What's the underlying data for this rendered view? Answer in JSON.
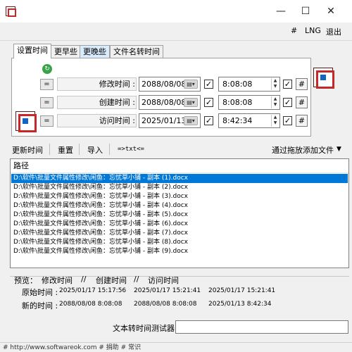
{
  "window": {
    "minimize": "—",
    "maximize": "☐",
    "close": "✕"
  },
  "toolbar": {
    "hash": "#",
    "lng": "LNG",
    "exit": "退出"
  },
  "tabs": [
    "设置时间",
    "更早些",
    "更晚些",
    "文件名转时间"
  ],
  "time_rows": [
    {
      "eq": "=",
      "label": "修改时间 :",
      "date": "2088/08/08",
      "time": "8:08:08",
      "hash": "#"
    },
    {
      "eq": "=",
      "label": "创建时间 :",
      "date": "2088/08/08",
      "time": "8:08:08",
      "hash": "#"
    },
    {
      "eq": "=",
      "label": "访问时间 :",
      "date": "2025/01/13",
      "time": "8:42:34",
      "hash": "#"
    }
  ],
  "checkmark": "✓",
  "actions": {
    "update": "更新时间",
    "reset": "重置",
    "import": "导入",
    "txt": "=>txt<=",
    "drag_add": "通过拖放添加文件",
    "drag_arrow": "▼"
  },
  "file_list": {
    "header": "路径",
    "rows": [
      "D:\\软件\\批量文件属性修改\\闲鱼：忘忧草小铺 - 副本 (1).docx",
      "D:\\软件\\批量文件属性修改\\闲鱼：忘忧草小铺 - 副本 (2).docx",
      "D:\\软件\\批量文件属性修改\\闲鱼：忘忧草小铺 - 副本 (3).docx",
      "D:\\软件\\批量文件属性修改\\闲鱼：忘忧草小铺 - 副本 (4).docx",
      "D:\\软件\\批量文件属性修改\\闲鱼：忘忧草小铺 - 副本 (5).docx",
      "D:\\软件\\批量文件属性修改\\闲鱼：忘忧草小铺 - 副本 (6).docx",
      "D:\\软件\\批量文件属性修改\\闲鱼：忘忧草小铺 - 副本 (7).docx",
      "D:\\软件\\批量文件属性修改\\闲鱼：忘忧草小铺 - 副本 (8).docx",
      "D:\\软件\\批量文件属性修改\\闲鱼：忘忧草小铺 - 副本 (9).docx"
    ]
  },
  "preview": {
    "label": "预览：",
    "col1": "修改时间",
    "div": "//",
    "col2": "创建时间",
    "col3": "访问时间",
    "original_label": "原始时间 :",
    "original": [
      "2025/01/17 15:17:56",
      "2025/01/17 15:21:41",
      "2025/01/17 15:21:41"
    ],
    "new_label": "新的时间 :",
    "new": [
      "2088/08/08 8:08:08",
      "2088/08/08 8:08:08",
      "2025/01/13 8:42:34"
    ]
  },
  "tester": {
    "label": "文本转时间测试器",
    "value": ""
  },
  "status": "# http://www.softwareok.com   # 捐助   # 常识",
  "colors": {
    "selection": "#0078d7",
    "icon_red": "#c62828",
    "refresh_green": "#3aa24a"
  }
}
